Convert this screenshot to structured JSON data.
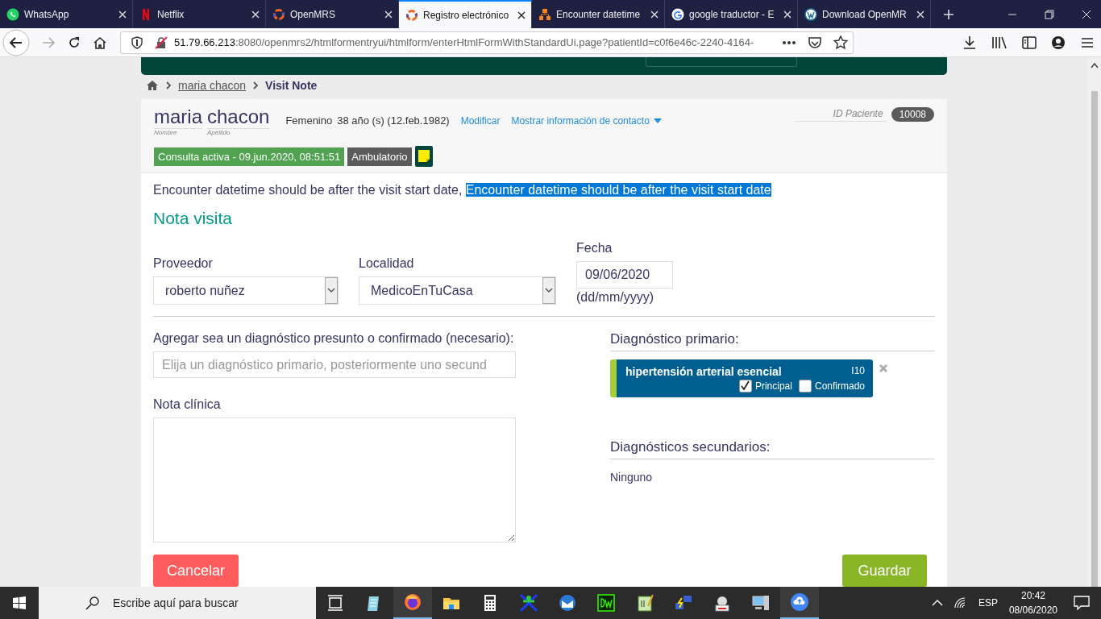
{
  "browser": {
    "tabs": [
      {
        "title": "WhatsApp",
        "selected": false
      },
      {
        "title": "Netflix",
        "selected": false
      },
      {
        "title": "OpenMRS",
        "selected": false
      },
      {
        "title": "Registro electrónico",
        "selected": true
      },
      {
        "title": "Encounter datetime",
        "selected": false
      },
      {
        "title": "google traductor - E",
        "selected": false
      },
      {
        "title": "Download OpenMR",
        "selected": false
      }
    ],
    "url_host": "51.79.66.213",
    "url_rest": ":8080/openmrs2/htmlformentryui/htmlform/enterHtmlFormWithStandardUi.page?patientId=c0f6e46c-2240-4164-"
  },
  "breadcrumb": {
    "patient": "maria chacon ",
    "page": "Visit Note"
  },
  "patient": {
    "given": "maria",
    "family": "chacon",
    "given_label": "Nombre",
    "family_label": "Apellido",
    "gender": "Femenino",
    "age": "38 año (s) (12.feb.1982)",
    "edit_link": "Modificar",
    "contact_link": "Mostrar información de contacto",
    "id_label": "ID Paciente",
    "id": "10008",
    "visit_badge": "Consulta activa - 09.jun.2020, 08:51:51",
    "type_badge": "Ambulatorio"
  },
  "message": [
    {
      "text": "Encounter datetime should be after the visit start date, ",
      "selected": false
    },
    {
      "text": "Encounter datetime should be after the visit start date",
      "selected": true
    }
  ],
  "form": {
    "title": "Nota visita",
    "provider_label": "Proveedor",
    "provider": "roberto nuñez",
    "location_label": "Localidad",
    "location": "MedicoEnTuCasa",
    "date_label": "Fecha",
    "date": "09/06/2020",
    "date_hint": "(dd/mm/yyyy)",
    "diagnosis_label": "Agregar sea un diagnóstico presunto o confirmado (necesario):",
    "diagnosis_placeholder": "Elija un diagnóstico primario, posteriormente uno secund",
    "note_label": "Nota clínica",
    "primary_title": "Diagnóstico primario:",
    "primary": {
      "name": "hipertensión arterial esencial",
      "code": "I10",
      "options": [
        {
          "label": "Principal",
          "checked": true
        },
        {
          "label": "Confirmado",
          "checked": false
        }
      ]
    },
    "secondary_title": "Diagnósticos secundarios:",
    "secondary_empty": "Ninguno",
    "cancel": "Cancelar",
    "save": "Guardar"
  },
  "taskbar": {
    "search_placeholder": "Escribe aquí para buscar",
    "apps": [
      {
        "kind": "taskview",
        "active": false
      },
      {
        "kind": "notepad",
        "active": false
      },
      {
        "kind": "firefox",
        "active": true
      },
      {
        "kind": "folder",
        "active": false
      },
      {
        "kind": "calculator",
        "active": false
      },
      {
        "kind": "figure",
        "active": false
      },
      {
        "kind": "mail",
        "active": false
      },
      {
        "kind": "dw",
        "active": false
      },
      {
        "kind": "editor",
        "active": false
      },
      {
        "kind": "network",
        "active": false
      },
      {
        "kind": "pdf",
        "active": false
      },
      {
        "kind": "computer",
        "active": false
      },
      {
        "kind": "cloud",
        "active": true
      }
    ],
    "language": "ESP",
    "time": "20:42",
    "date": "08/06/2020"
  }
}
